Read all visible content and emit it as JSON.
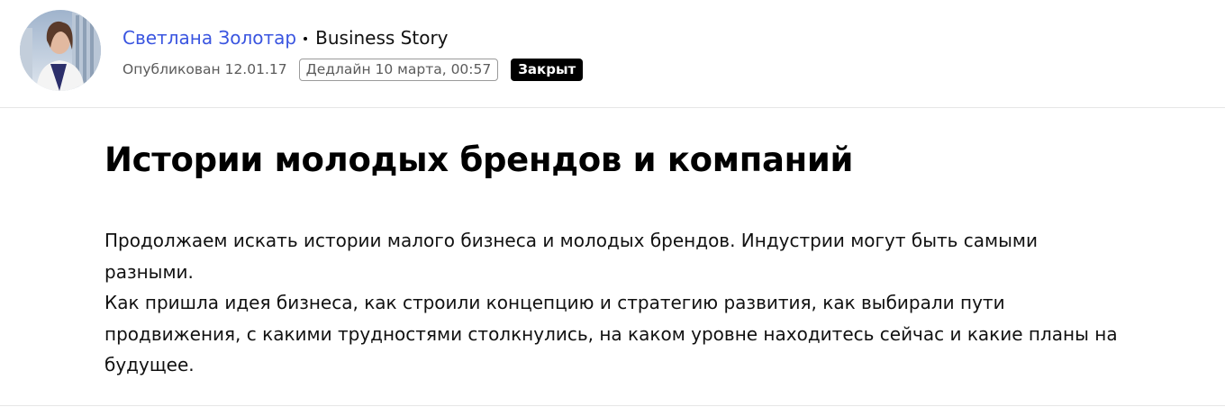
{
  "header": {
    "avatar_alt": "Светлана Золотар",
    "author_name": "Светлана Золотар",
    "community": "Business Story",
    "published": "Опубликован 12.01.17",
    "deadline": "Дедлайн 10 марта, 00:57",
    "status": "Закрыт"
  },
  "article": {
    "title": "Истории молодых брендов и компаний",
    "paragraphs": [
      "Продолжаем искать истории малого бизнеса и молодых брендов. Индустрии могут быть самыми разными.",
      "Как пришла идея бизнеса, как строили концепцию и стратегию развития, как выбирали пути продвижения, с какими трудностями столкнулись, на каком уровне находитесь сейчас и какие планы на будущее."
    ]
  },
  "colors": {
    "author_link": "#3a55e0",
    "badge_bg": "#000000",
    "divider": "#e6e6e6"
  }
}
